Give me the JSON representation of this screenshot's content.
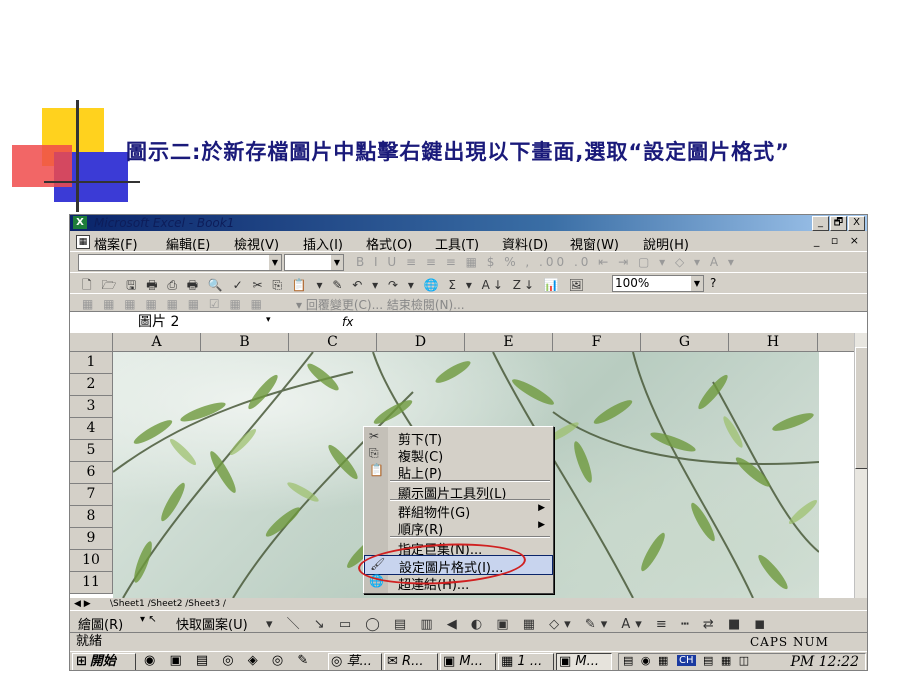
{
  "slide": {
    "title": "圖示二:於新存檔圖片中點擊右鍵出現以下畫面,選取“設定圖片格式”"
  },
  "window": {
    "title": "Microsoft Excel - Book1",
    "buttons": [
      "_",
      "🗗",
      "X"
    ]
  },
  "menu": {
    "items": [
      "檔案(F)",
      "編輯(E)",
      "檢視(V)",
      "插入(I)",
      "格式(O)",
      "工具(T)",
      "資料(D)",
      "視窗(W)",
      "說明(H)"
    ],
    "mdi_controls": "_ ▫ ×"
  },
  "toolbar_format": {
    "glyphs": "B  I  U  ≡ ≡ ≡ ▦  $ %  ,  .00 .0  ⇤ ⇥  ▢ ▾  ◇ ▾  A ▾"
  },
  "toolbar_standard": {
    "glyphs": "🗋 🗁 🖫 🖶 ⎙  🖶 🔍 ✓  ✂ ⎘ 📋 ▾ ✎  ↶ ▾ ↷ ▾  🌐 Σ ▾ A↓ Z↓  📊 🖼",
    "zoom": "100%",
    "help": "?"
  },
  "toolbar_review": {
    "text": "▾ 回覆變更(C)... 結束檢閱(N)..."
  },
  "formula_bar": {
    "name_box": "圖片 2",
    "fx": "fx"
  },
  "grid": {
    "columns": [
      "A",
      "B",
      "C",
      "D",
      "E",
      "F",
      "G",
      "H"
    ],
    "rows": [
      "1",
      "2",
      "3",
      "4",
      "5",
      "6",
      "7",
      "8",
      "9",
      "10",
      "11"
    ]
  },
  "sheet_tabs": "\\Sheet1 /Sheet2 /Sheet3 /",
  "context_menu": {
    "items": [
      {
        "icon": "✂",
        "label": "剪下(T)"
      },
      {
        "icon": "⎘",
        "label": "複製(C)"
      },
      {
        "icon": "📋",
        "label": "貼上(P)"
      },
      {
        "icon": "",
        "label": "顯示圖片工具列(L)"
      },
      {
        "icon": "",
        "label": "群組物件(G)",
        "submenu": "▶"
      },
      {
        "icon": "",
        "label": "順序(R)",
        "submenu": "▶"
      },
      {
        "icon": "",
        "label": "指定巨集(N)..."
      },
      {
        "icon": "🖌",
        "label": "設定圖片格式(I)..."
      },
      {
        "icon": "🌐",
        "label": "超連結(H)..."
      }
    ]
  },
  "draw_toolbar": {
    "draw_label": "繪圖(R)",
    "autoshapes_label": "快取圖案(U)"
  },
  "status_bar": {
    "left": "就緒",
    "right": "CAPS NUM"
  },
  "taskbar": {
    "start": "開始",
    "tasks": [
      "草...",
      "R...",
      "M...",
      "1 ...",
      "M..."
    ],
    "clock": "PM 12:22",
    "ime": "CH"
  },
  "colors": {
    "slide_title": "#1a1a7a",
    "deco_yellow": "#ffd21e",
    "deco_blue": "#3b3bd6",
    "deco_red": "#f04b4b",
    "highlight_oval": "#d02020"
  }
}
